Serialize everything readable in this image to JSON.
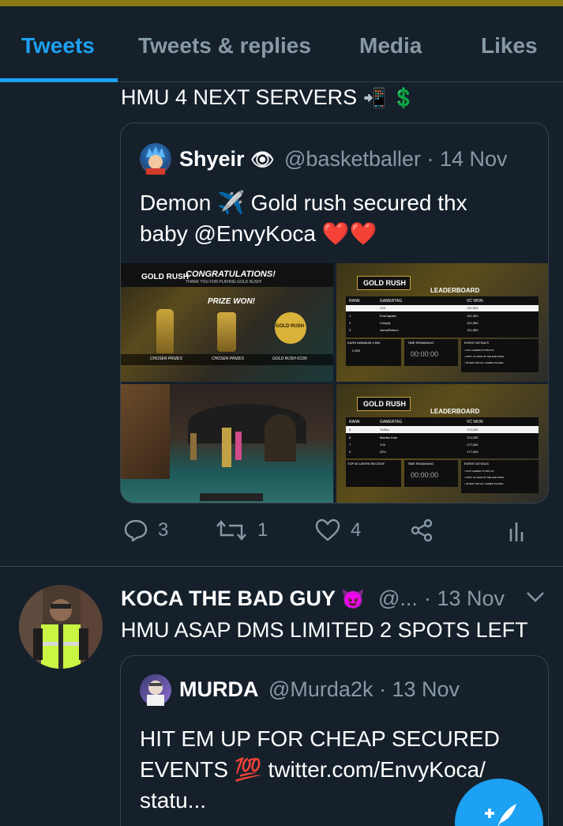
{
  "tabs": [
    {
      "label": "Tweets",
      "active": true
    },
    {
      "label": "Tweets & replies",
      "active": false
    },
    {
      "label": "Media",
      "active": false
    },
    {
      "label": "Likes",
      "active": false
    }
  ],
  "tweet1": {
    "text": "HMU 4 NEXT SERVERS",
    "emoji": "📲 💲",
    "quote": {
      "name": "Shyeir",
      "name_emoji": "👁",
      "handle": "@basketballer",
      "time": "· 14 Nov",
      "line1": "Demon ✈️ Gold rush secured thx",
      "line2": "baby @EnvyKoca ❤️❤️",
      "media": {
        "tile1": {
          "brand": "GOLD RUSH",
          "banner": "CONGRATULATIONS!",
          "banner_sub": "THANK YOU FOR PLAYING GOLD RUSH!",
          "prize": "PRIZE WON!",
          "captions": [
            "CHOSEN PRIZES",
            "CHOSEN PRIZES",
            "GOLD RUSH ICON"
          ],
          "icon": "GOLD RUSH"
        },
        "tile2": {
          "brand": "GOLD RUSH",
          "title": "LEADERBOARD",
          "headers": [
            "RANK",
            "GAMERTAG",
            "VC WON"
          ],
          "rows": [
            [
              "",
              "XJ3",
              "131,500"
            ],
            [
              "1",
              "EvaCapaist",
              "121,500"
            ],
            [
              "2",
              "Cinnply",
              "121,500"
            ],
            [
              "3",
              "JannsReborn",
              "121,500"
            ]
          ],
          "panel1": "EARN MINIMUM 2,500",
          "panel1_val": "2,500",
          "panel2": "TIME REMAINING",
          "timer": "00:00:00",
          "panel3": "EVENT DETAILS",
          "details": [
            "• PLAY GAMES TO WIN VC.",
            "• POST VC WON AT THE END WINS.",
            "• 25 REP FOR ALL GAMES PLAYED."
          ]
        },
        "tile4": {
          "brand": "GOLD RUSH",
          "title": "LEADERBOARD",
          "headers": [
            "RANK",
            "GAMERTAG",
            "VC WON"
          ],
          "rows": [
            [
              "6",
              "TuShu",
              "174,250"
            ],
            [
              "8",
              "Marlise Kam",
              "174,250"
            ],
            [
              "7",
              "XJ3",
              "177,000"
            ],
            [
              "9",
              "UFX",
              "177,000"
            ]
          ],
          "panel1": "TOP 50 USERS RECEIVE",
          "panel2": "TIME REMAINING",
          "timer": "00:00:00",
          "panel3": "EVENT DETAILS",
          "details": [
            "• PLAY GAMES TO WIN VC.",
            "• POST VC WON AT THE END WINS.",
            "• 25 REP FOR ALL GAMES PLAYED."
          ]
        }
      }
    },
    "replies": "3",
    "retweets": "1",
    "likes": "4"
  },
  "tweet2": {
    "name": "KOCA THE BAD GUY",
    "name_emoji": "😈",
    "handle": "@...",
    "time": "· 13 Nov",
    "text": "HMU ASAP DMS LIMITED 2 SPOTS LEFT",
    "quote": {
      "name": "MURDA",
      "handle": "@Murda2k",
      "time": "· 13 Nov",
      "line1": "HIT EM UP FOR CHEAP SECURED",
      "line2": "EVENTS 💯 twitter.com/EnvyKoca/",
      "line3": "statu..."
    }
  },
  "colors": {
    "background": "#15202b",
    "accent": "#1da1f2",
    "secondary_text": "#8899a6",
    "border": "#38444d",
    "top_strip": "#8a7a14",
    "gold": "#f6d64a"
  }
}
